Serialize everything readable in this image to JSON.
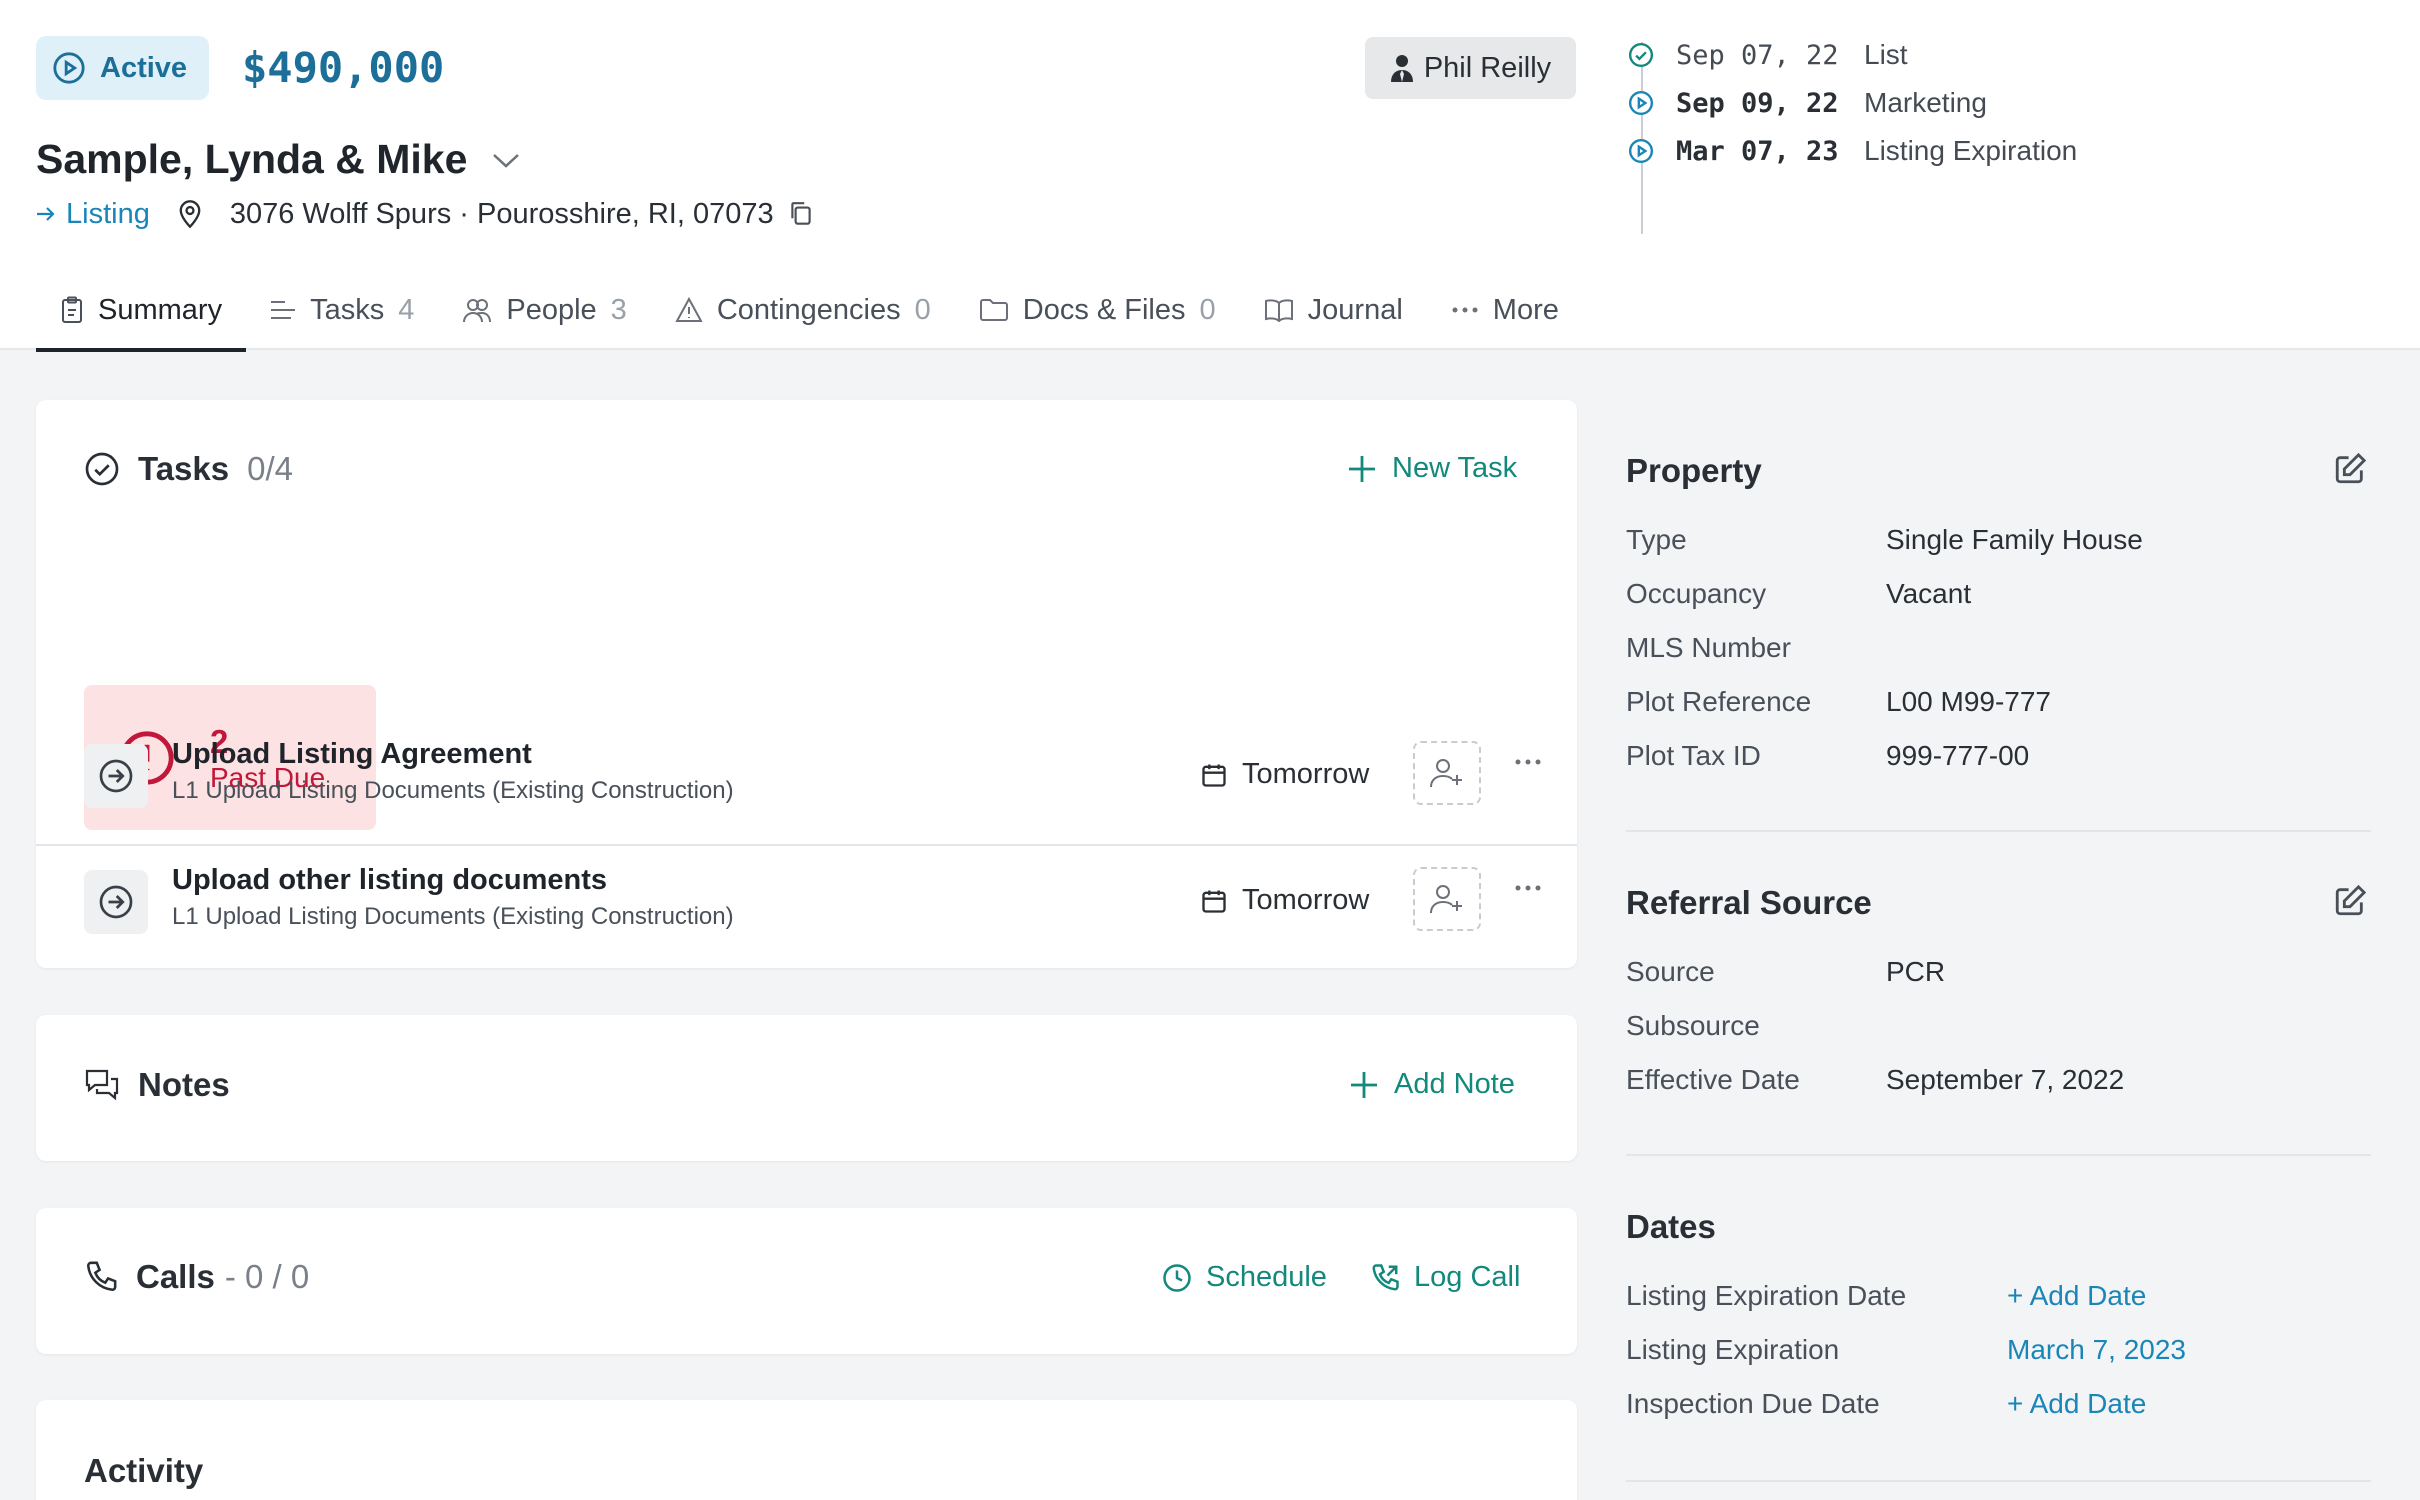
{
  "header": {
    "status": "Active",
    "price": "$490,000",
    "agent": "Phil Reilly",
    "title": "Sample, Lynda & Mike",
    "listing_link": "Listing",
    "address": "3076 Wolff Spurs · Pourosshire, RI, 07073"
  },
  "timeline": [
    {
      "date": "Sep 07, 22",
      "label": "List"
    },
    {
      "date": "Sep 09, 22",
      "label": "Marketing"
    },
    {
      "date": "Mar 07, 23",
      "label": "Listing Expiration"
    }
  ],
  "tabs": [
    {
      "label": "Summary",
      "count": ""
    },
    {
      "label": "Tasks",
      "count": "4"
    },
    {
      "label": "People",
      "count": "3"
    },
    {
      "label": "Contingencies",
      "count": "0"
    },
    {
      "label": "Docs & Files",
      "count": "0"
    },
    {
      "label": "Journal",
      "count": ""
    },
    {
      "label": "More",
      "count": ""
    }
  ],
  "tasks_card": {
    "title": "Tasks",
    "count": "0/4",
    "new_task": "New Task",
    "past_due_count": "2",
    "past_due_label": "Past Due",
    "items": [
      {
        "name": "Upload Listing Agreement",
        "sub": "L1 Upload Listing Documents (Existing Construction)",
        "due": "Tomorrow"
      },
      {
        "name": "Upload other listing documents",
        "sub": "L1 Upload Listing Documents (Existing Construction)",
        "due": "Tomorrow"
      }
    ]
  },
  "notes_card": {
    "title": "Notes",
    "add": "Add Note"
  },
  "calls_card": {
    "title": "Calls",
    "count": "- 0 / 0",
    "schedule": "Schedule",
    "log": "Log Call"
  },
  "activity_card": {
    "title": "Activity"
  },
  "property": {
    "title": "Property",
    "rows": [
      {
        "key": "Type",
        "value": "Single Family House"
      },
      {
        "key": "Occupancy",
        "value": "Vacant"
      },
      {
        "key": "MLS Number",
        "value": ""
      },
      {
        "key": "Plot Reference",
        "value": "L00 M99-777"
      },
      {
        "key": "Plot Tax ID",
        "value": "999-777-00"
      }
    ]
  },
  "referral": {
    "title": "Referral Source",
    "rows": [
      {
        "key": "Source",
        "value": "PCR"
      },
      {
        "key": "Subsource",
        "value": ""
      },
      {
        "key": "Effective Date",
        "value": "September 7, 2022"
      }
    ]
  },
  "dates": {
    "title": "Dates",
    "rows": [
      {
        "key": "Listing Expiration Date",
        "value": "+ Add Date"
      },
      {
        "key": "Listing Expiration",
        "value": "March 7, 2023"
      },
      {
        "key": "Inspection Due Date",
        "value": "+ Add Date"
      }
    ]
  },
  "colors": {
    "accent": "#1a86b8",
    "green": "#13897d",
    "danger": "#c0173a"
  }
}
